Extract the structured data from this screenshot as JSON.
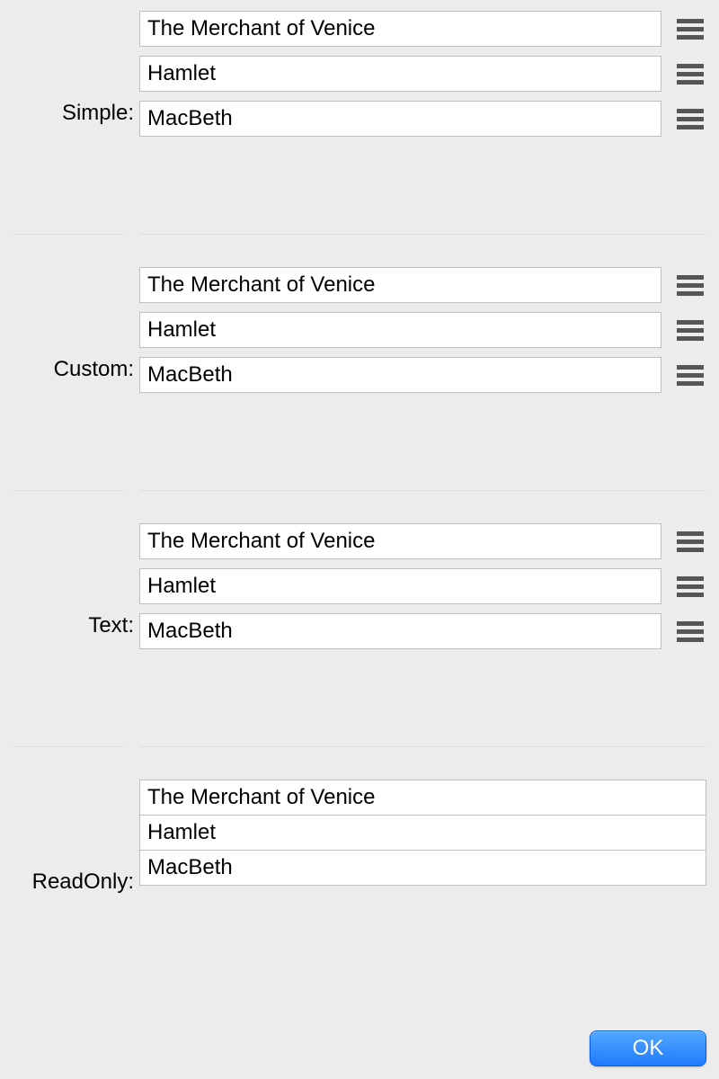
{
  "sections": [
    {
      "key": "simple",
      "label": "Simple:",
      "readOnly": false,
      "items": [
        "The Merchant of Venice",
        "Hamlet",
        "MacBeth"
      ]
    },
    {
      "key": "custom",
      "label": "Custom:",
      "readOnly": false,
      "items": [
        "The Merchant of Venice",
        "Hamlet",
        "MacBeth"
      ]
    },
    {
      "key": "text",
      "label": "Text:",
      "readOnly": false,
      "items": [
        "The Merchant of Venice",
        "Hamlet",
        "MacBeth"
      ]
    },
    {
      "key": "readonly",
      "label": "ReadOnly:",
      "readOnly": true,
      "items": [
        "The Merchant of Venice",
        "Hamlet",
        "MacBeth"
      ]
    }
  ],
  "footer": {
    "ok_label": "OK"
  }
}
